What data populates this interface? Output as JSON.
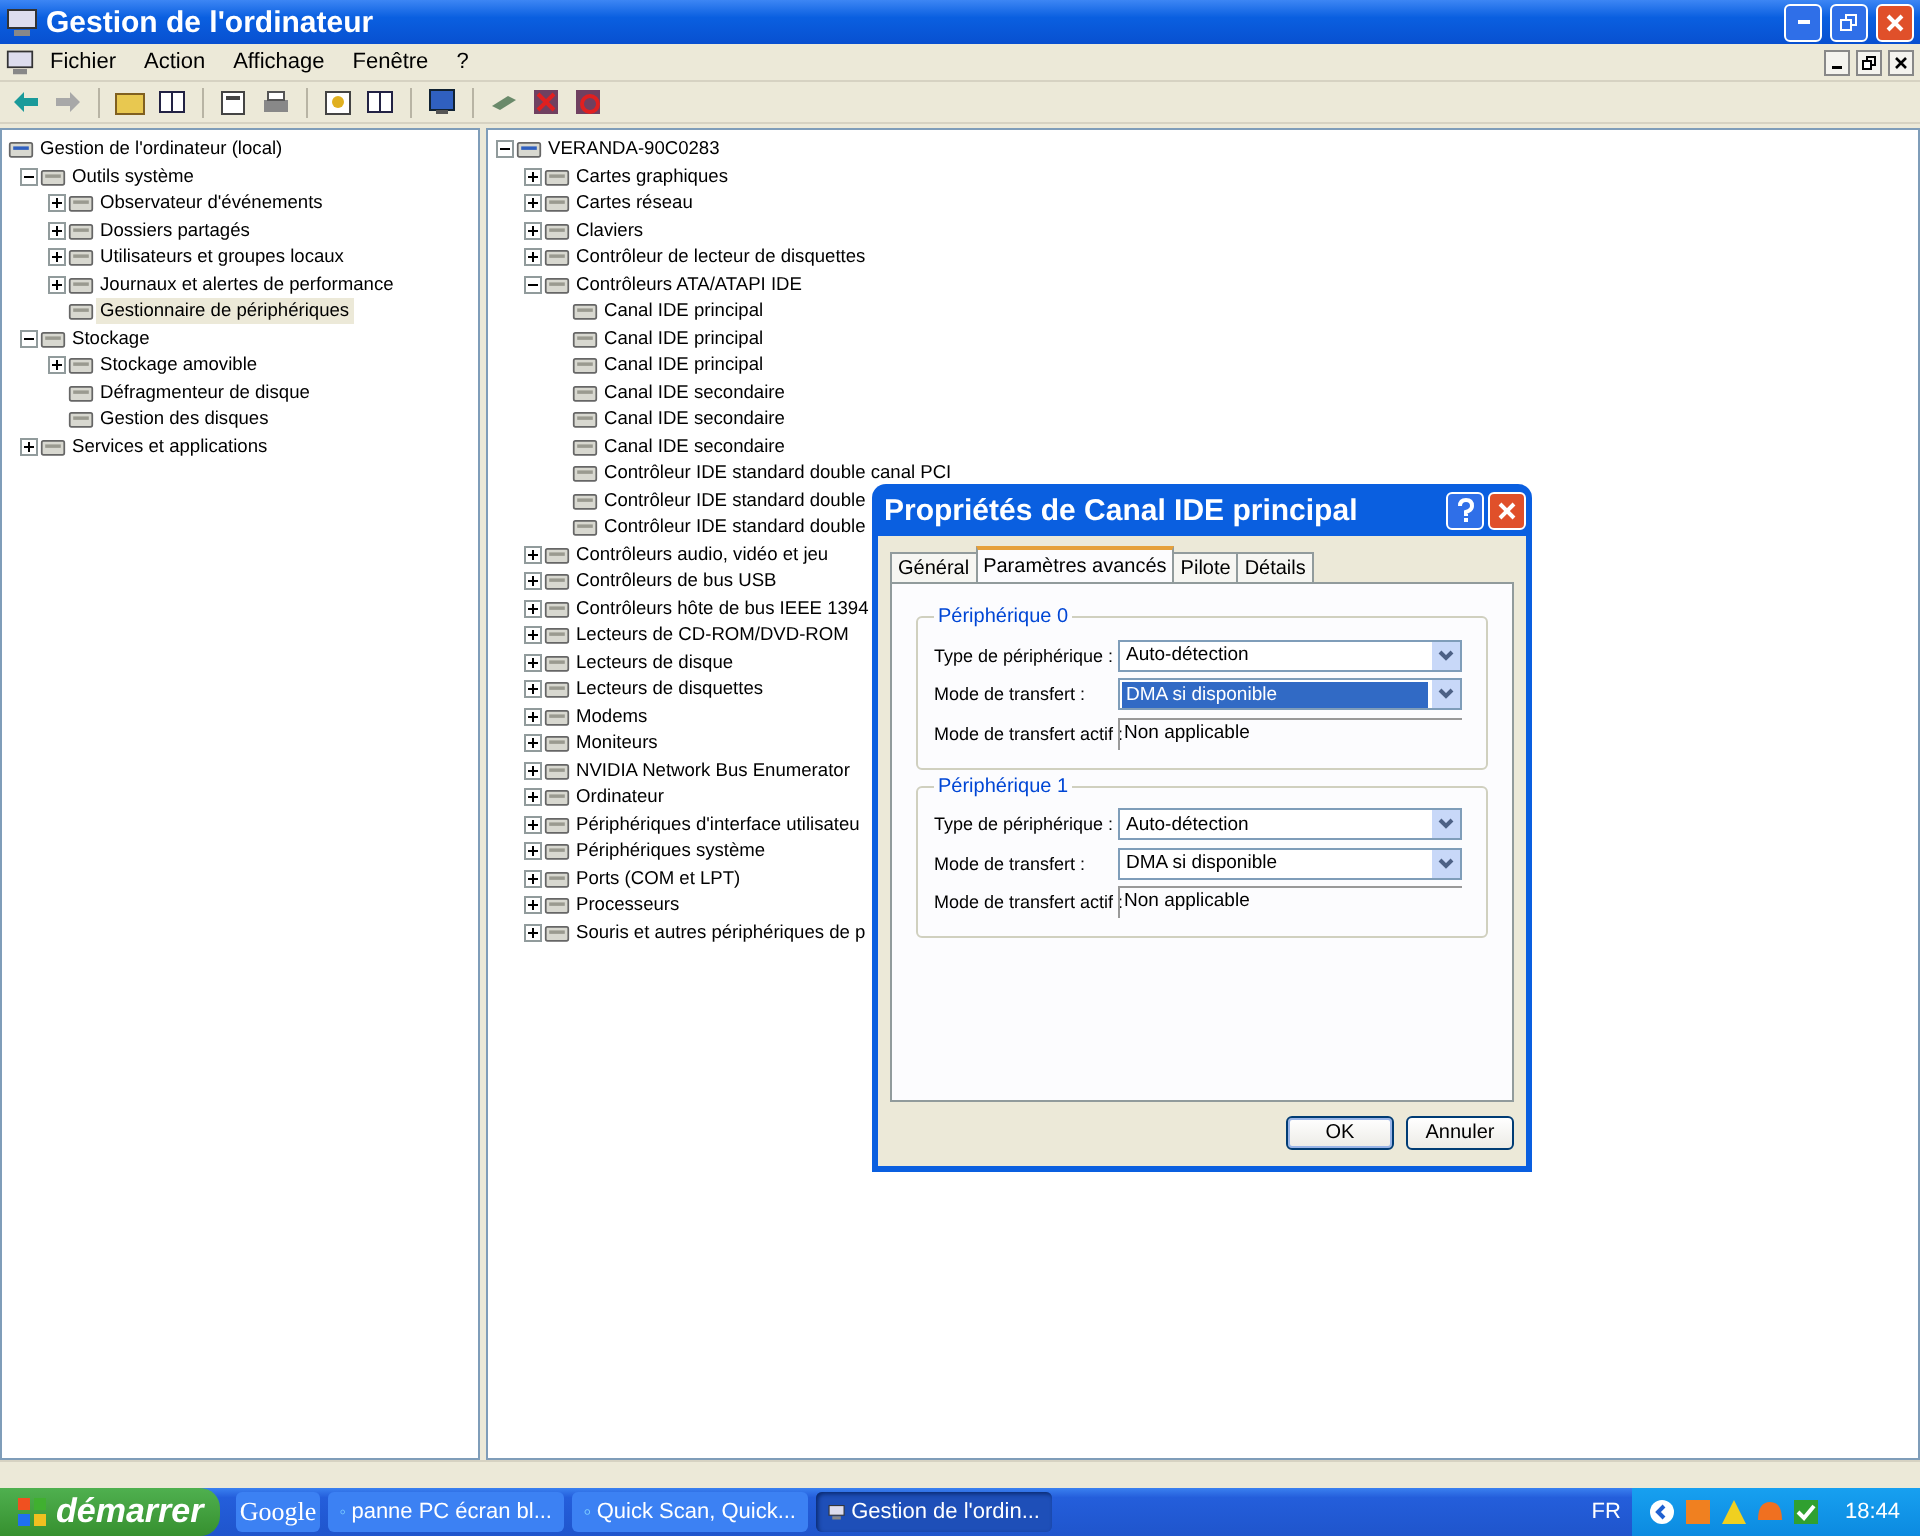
{
  "window": {
    "title": "Gestion de l'ordinateur"
  },
  "menu": [
    "Fichier",
    "Action",
    "Affichage",
    "Fenêtre",
    "?"
  ],
  "left_tree": [
    {
      "label": "Gestion de l'ordinateur (local)",
      "selected": false,
      "children": [
        {
          "label": "Outils système",
          "expanded": true,
          "selected": false,
          "children": [
            {
              "label": "Observateur d'événements",
              "expanded": false,
              "selected": false
            },
            {
              "label": "Dossiers partagés",
              "expanded": false,
              "selected": false
            },
            {
              "label": "Utilisateurs et groupes locaux",
              "expanded": false,
              "selected": false
            },
            {
              "label": "Journaux et alertes de performance",
              "expanded": false,
              "selected": false
            },
            {
              "label": "Gestionnaire de périphériques",
              "selected": true
            }
          ]
        },
        {
          "label": "Stockage",
          "expanded": true,
          "selected": false,
          "children": [
            {
              "label": "Stockage amovible",
              "expanded": false,
              "selected": false
            },
            {
              "label": "Défragmenteur de disque",
              "selected": false
            },
            {
              "label": "Gestion des disques",
              "selected": false
            }
          ]
        },
        {
          "label": "Services et applications",
          "expanded": false,
          "selected": false
        }
      ]
    }
  ],
  "device_tree": [
    {
      "label": "VERANDA-90C0283",
      "expanded": true,
      "children": [
        {
          "label": "Cartes graphiques",
          "expanded": false
        },
        {
          "label": "Cartes réseau",
          "expanded": false
        },
        {
          "label": "Claviers",
          "expanded": false
        },
        {
          "label": "Contrôleur de lecteur de disquettes",
          "expanded": false
        },
        {
          "label": "Contrôleurs ATA/ATAPI IDE",
          "expanded": true,
          "children": [
            {
              "label": "Canal IDE principal"
            },
            {
              "label": "Canal IDE principal"
            },
            {
              "label": "Canal IDE principal"
            },
            {
              "label": "Canal IDE secondaire"
            },
            {
              "label": "Canal IDE secondaire"
            },
            {
              "label": "Canal IDE secondaire"
            },
            {
              "label": "Contrôleur IDE standard double canal PCI"
            },
            {
              "label": "Contrôleur IDE standard double"
            },
            {
              "label": "Contrôleur IDE standard double"
            }
          ]
        },
        {
          "label": "Contrôleurs audio, vidéo et jeu",
          "expanded": false
        },
        {
          "label": "Contrôleurs de bus USB",
          "expanded": false
        },
        {
          "label": "Contrôleurs hôte de bus IEEE 1394",
          "expanded": false
        },
        {
          "label": "Lecteurs de CD-ROM/DVD-ROM",
          "expanded": false
        },
        {
          "label": "Lecteurs de disque",
          "expanded": false
        },
        {
          "label": "Lecteurs de disquettes",
          "expanded": false
        },
        {
          "label": "Modems",
          "expanded": false
        },
        {
          "label": "Moniteurs",
          "expanded": false
        },
        {
          "label": "NVIDIA Network Bus Enumerator",
          "expanded": false
        },
        {
          "label": "Ordinateur",
          "expanded": false
        },
        {
          "label": "Périphériques d'interface utilisateu",
          "expanded": false
        },
        {
          "label": "Périphériques système",
          "expanded": false
        },
        {
          "label": "Ports (COM et LPT)",
          "expanded": false
        },
        {
          "label": "Processeurs",
          "expanded": false
        },
        {
          "label": "Souris et autres périphériques de p",
          "expanded": false
        }
      ]
    }
  ],
  "dialog": {
    "title": "Propriétés de Canal IDE principal",
    "tabs": [
      {
        "label": "Général",
        "selected": false
      },
      {
        "label": "Paramètres avancés",
        "selected": true
      },
      {
        "label": "Pilote",
        "selected": false
      },
      {
        "label": "Détails",
        "selected": false
      }
    ],
    "groups": [
      {
        "title": "Périphérique 0",
        "rows": [
          {
            "label": "Type de périphérique :",
            "value": "Auto-détection",
            "kind": "combo",
            "selected": false
          },
          {
            "label": "Mode de transfert :",
            "value": "DMA si disponible",
            "kind": "combo",
            "selected": true
          },
          {
            "label": "Mode de transfert actif :",
            "value": "Non applicable",
            "kind": "readonly",
            "selected": false
          }
        ]
      },
      {
        "title": "Périphérique 1",
        "rows": [
          {
            "label": "Type de périphérique :",
            "value": "Auto-détection",
            "kind": "combo",
            "selected": false
          },
          {
            "label": "Mode de transfert :",
            "value": "DMA si disponible",
            "kind": "combo",
            "selected": false
          },
          {
            "label": "Mode de transfert actif :",
            "value": "Non applicable",
            "kind": "readonly",
            "selected": false
          }
        ]
      }
    ],
    "buttons": [
      {
        "label": "OK",
        "default": true
      },
      {
        "label": "Annuler",
        "default": false
      }
    ]
  },
  "taskbar": {
    "start": "démarrer",
    "items": [
      {
        "label": "Google",
        "kind": "toolbar",
        "selected": false
      },
      {
        "label": "panne PC écran bl...",
        "kind": "browser",
        "selected": false
      },
      {
        "label": "Quick Scan, Quick...",
        "kind": "browser",
        "selected": false
      },
      {
        "label": "Gestion de l'ordin...",
        "kind": "computer",
        "selected": true
      }
    ],
    "language": "FR",
    "clock": "18:44"
  }
}
